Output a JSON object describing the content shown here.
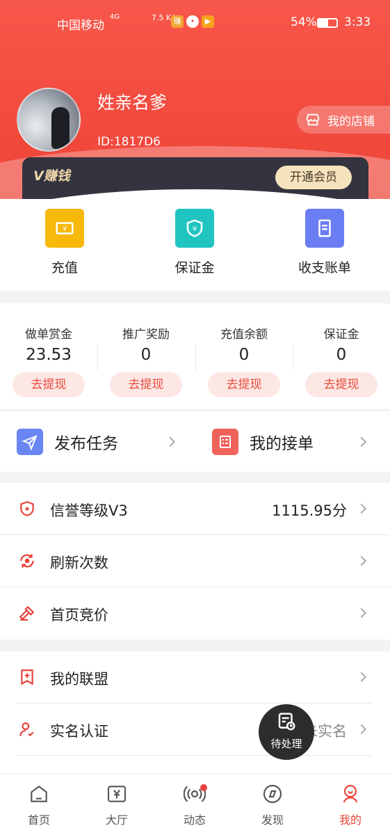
{
  "status_bar": {
    "carrier": "中国移动",
    "net_label": "4G",
    "speed": "7.5 K/s",
    "battery_pct": "54%",
    "battery_level": 0.54,
    "time": "3:33"
  },
  "profile": {
    "name": "姓亲名爹",
    "id": "ID:1817D6",
    "shop_label": "我的店铺"
  },
  "vip": {
    "label": "V赚钱",
    "button": "开通会员"
  },
  "quick_actions": [
    {
      "label": "充值",
      "icon": "recharge-icon",
      "color": "#f7b90c"
    },
    {
      "label": "保证金",
      "icon": "shield-yen-icon",
      "color": "#20c5c2"
    },
    {
      "label": "收支账单",
      "icon": "bill-icon",
      "color": "#6a7df3"
    }
  ],
  "balances": [
    {
      "title": "做单赏金",
      "value": "23.53",
      "action": "去提现"
    },
    {
      "title": "推广奖励",
      "value": "0",
      "action": "去提现"
    },
    {
      "title": "充值余额",
      "value": "0",
      "action": "去提现"
    },
    {
      "title": "保证金",
      "value": "0",
      "action": "去提现"
    }
  ],
  "tasks": {
    "publish": "发布任务",
    "my_orders": "我的接单"
  },
  "list1": [
    {
      "label": "信誉等级V3",
      "value": "1115.95分",
      "icon": "credit-badge-icon"
    },
    {
      "label": "刷新次数",
      "value": "",
      "icon": "refresh-icon"
    },
    {
      "label": "首页竞价",
      "value": "",
      "icon": "auction-hammer-icon"
    }
  ],
  "list2": [
    {
      "label": "我的联盟",
      "value": "",
      "icon": "alliance-icon"
    },
    {
      "label": "实名认证",
      "value": "未实名",
      "icon": "user-check-icon"
    }
  ],
  "pending": {
    "label": "待处理"
  },
  "tabs": [
    {
      "label": "首页",
      "icon": "home-icon"
    },
    {
      "label": "大厅",
      "icon": "hall-icon"
    },
    {
      "label": "动态",
      "icon": "broadcast-icon"
    },
    {
      "label": "发现",
      "icon": "compass-icon"
    },
    {
      "label": "我的",
      "icon": "profile-icon"
    }
  ],
  "colors": {
    "brand_red": "#f24a3e",
    "accent_red": "#e84c3d"
  }
}
